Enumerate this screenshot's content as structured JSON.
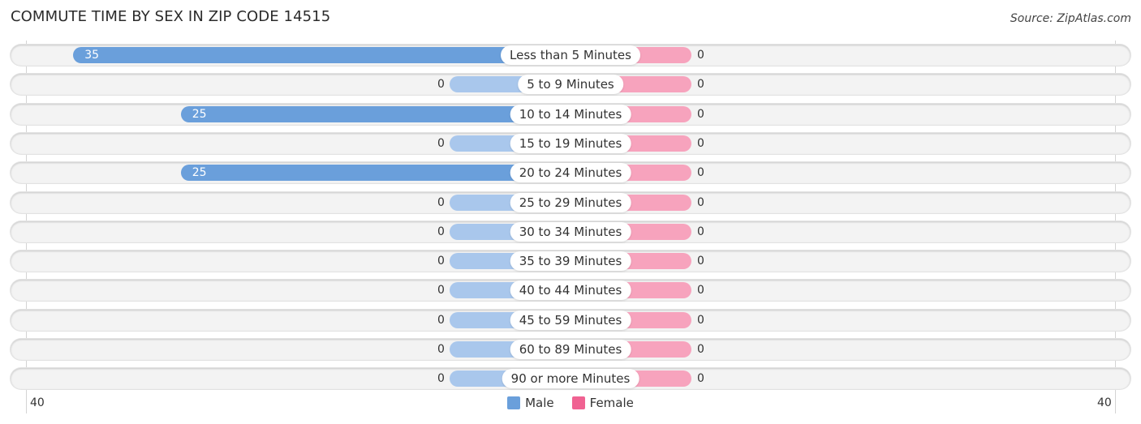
{
  "chart_data": {
    "type": "bar",
    "orientation": "horizontal-diverging",
    "title": "COMMUTE TIME BY SEX IN ZIP CODE 14515",
    "source": "Source: ZipAtlas.com",
    "categories": [
      "Less than 5 Minutes",
      "5 to 9 Minutes",
      "10 to 14 Minutes",
      "15 to 19 Minutes",
      "20 to 24 Minutes",
      "25 to 29 Minutes",
      "30 to 34 Minutes",
      "35 to 39 Minutes",
      "40 to 44 Minutes",
      "45 to 59 Minutes",
      "60 to 89 Minutes",
      "90 or more Minutes"
    ],
    "series": [
      {
        "name": "Male",
        "color": "#6a9fdb",
        "zero_color": "#a9c7ec",
        "values": [
          35,
          0,
          25,
          0,
          25,
          0,
          0,
          0,
          0,
          0,
          0,
          0
        ]
      },
      {
        "name": "Female",
        "color": "#f7a3bd",
        "legend_color": "#f06292",
        "values": [
          0,
          0,
          0,
          0,
          0,
          0,
          0,
          0,
          0,
          0,
          0,
          0
        ]
      }
    ],
    "axis": {
      "left_tick": "40",
      "right_tick": "40",
      "max": 40
    },
    "legend": {
      "placement": "bottom-center",
      "entries": [
        "Male",
        "Female"
      ]
    }
  }
}
